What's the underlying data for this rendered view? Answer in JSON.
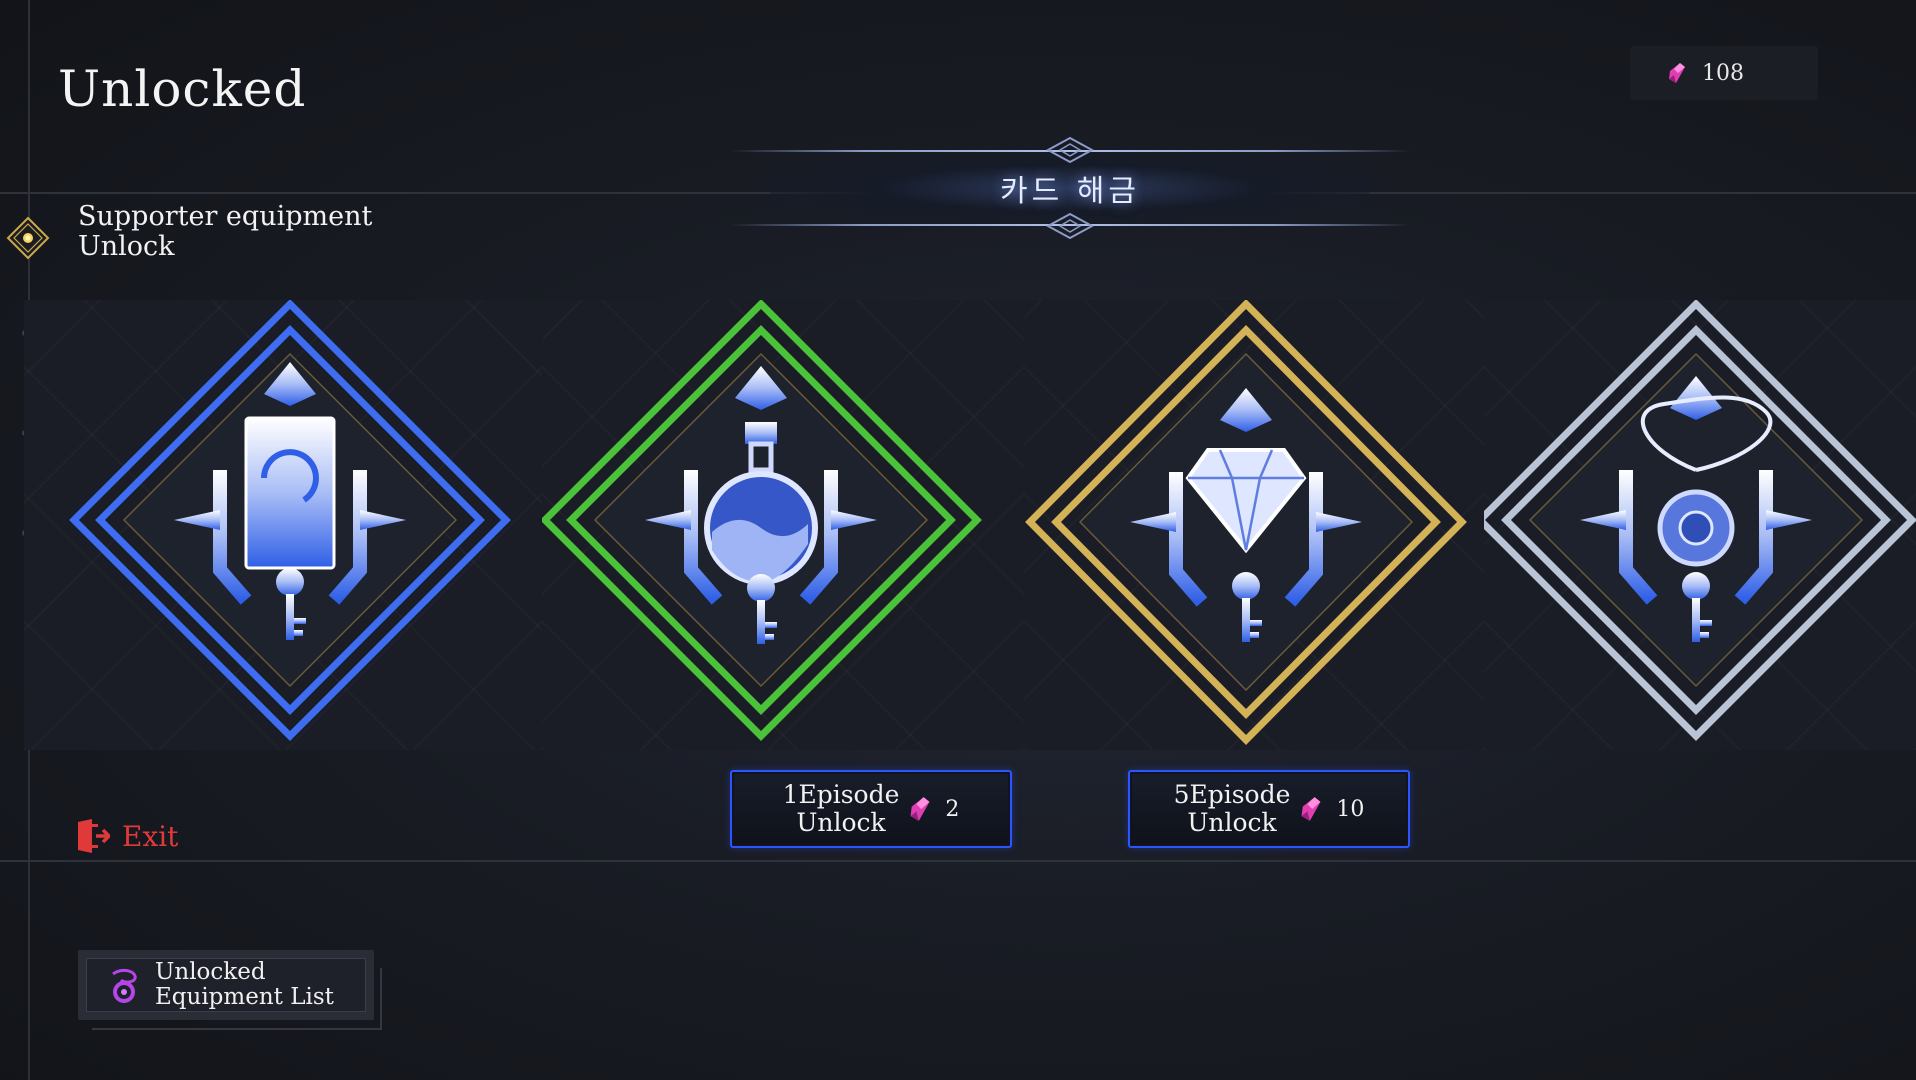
{
  "header": {
    "title": "Unlocked",
    "currency_amount": "108",
    "currency_icon": "pink-crystal-icon"
  },
  "banner": {
    "title": "카드 해금"
  },
  "section": {
    "label_line1": "Supporter equipment",
    "label_line2": "Unlock",
    "icon": "gold-diamond-lantern-icon"
  },
  "cards": [
    {
      "item": "card-icon",
      "frame_color": "#3f6df2"
    },
    {
      "item": "potion-icon",
      "frame_color": "#4cc23a"
    },
    {
      "item": "diamond-icon",
      "frame_color": "#d4b257"
    },
    {
      "item": "pendant-icon",
      "frame_color": "#b9c4d6"
    }
  ],
  "unlock_buttons": [
    {
      "line1": "1Episode",
      "line2": "Unlock",
      "cost": "2",
      "border_color": "#2c55ff"
    },
    {
      "line1": "5Episode",
      "line2": "Unlock",
      "cost": "10",
      "border_color": "#2c55ff"
    }
  ],
  "exit": {
    "label": "Exit",
    "color": "#e0393a"
  },
  "equipment_list": {
    "line1": "Unlocked",
    "line2": "Equipment List",
    "icon": "purple-ring-icon"
  }
}
